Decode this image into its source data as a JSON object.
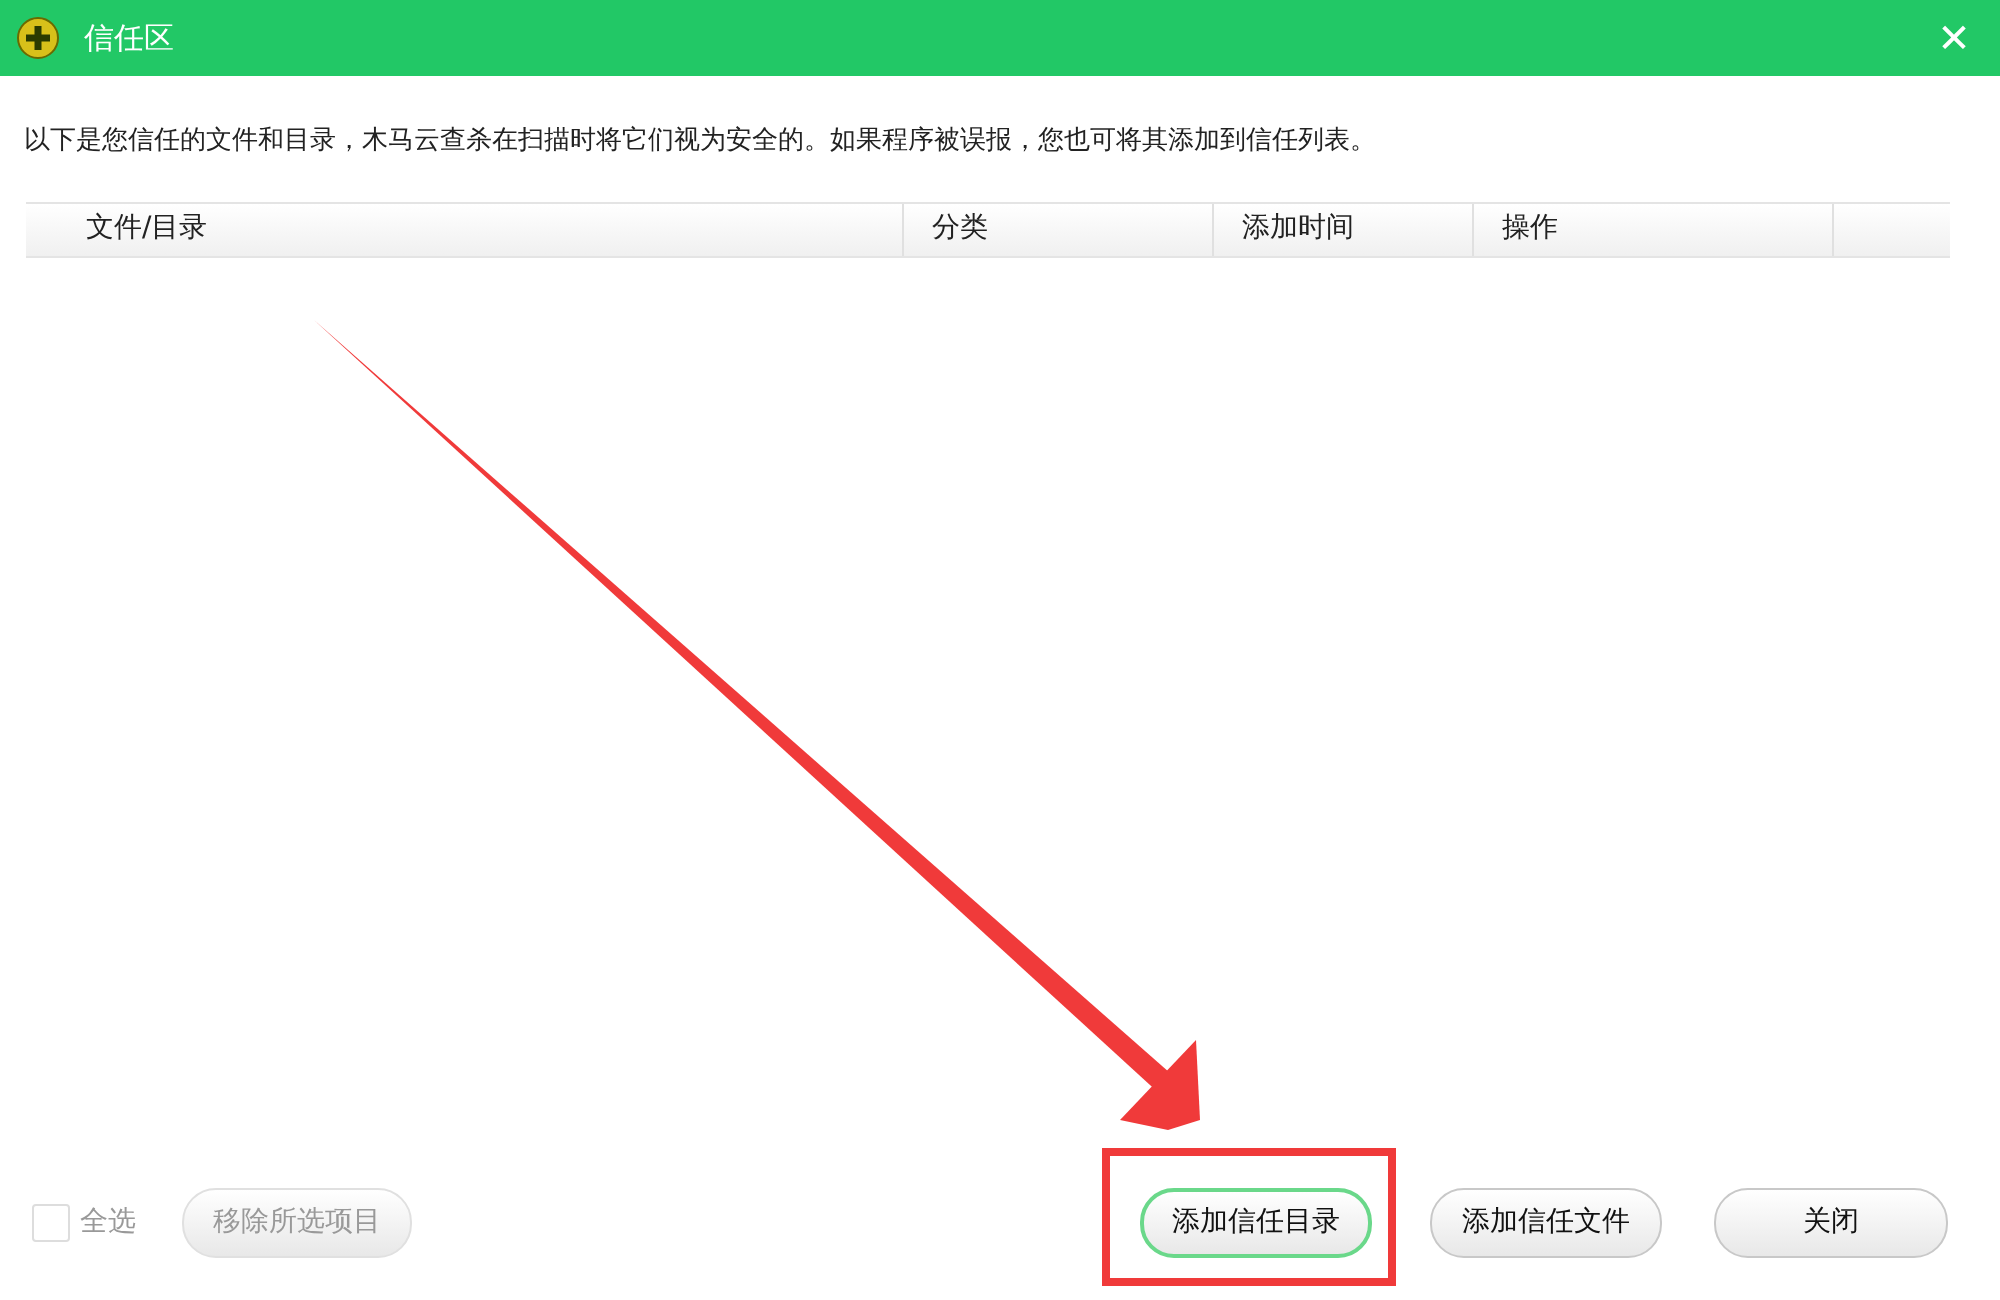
{
  "window": {
    "title": "信任区",
    "close": "✕"
  },
  "intro": "以下是您信任的文件和目录，木马云查杀在扫描时将它们视为安全的。如果程序被误报，您也可将其添加到信任列表。",
  "table": {
    "columns": [
      "文件/目录",
      "分类",
      "添加时间",
      "操作"
    ]
  },
  "select_all": {
    "label": "全选",
    "checked": false,
    "disabled": true
  },
  "buttons": [
    {
      "label": "移除所选项目",
      "disabled": true,
      "focused": false
    },
    {
      "label": "添加信任目录",
      "disabled": false,
      "focused": true
    },
    {
      "label": "添加信任文件",
      "disabled": false,
      "focused": false
    },
    {
      "label": "关闭",
      "disabled": false,
      "focused": false
    }
  ]
}
